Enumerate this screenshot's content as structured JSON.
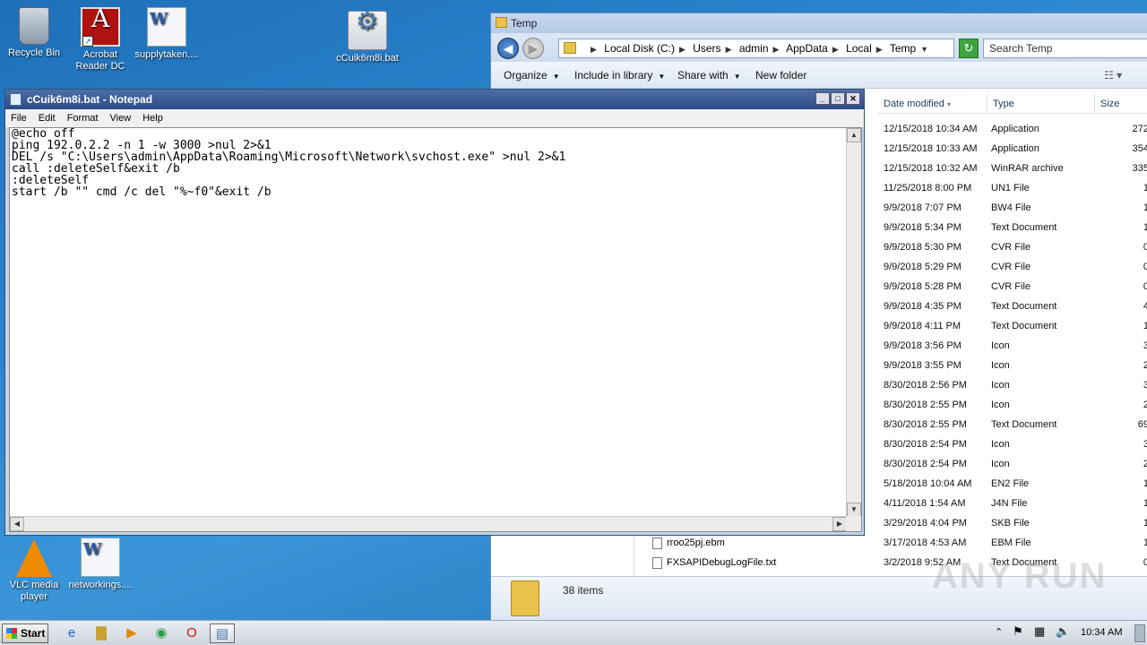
{
  "desktop": {
    "icons": [
      {
        "label": "Recycle Bin",
        "icon": "recycle-bin-icon"
      },
      {
        "label_line1": "Acrobat",
        "label_line2": "Reader DC",
        "icon": "acrobat-icon"
      },
      {
        "label": "supplytaken....",
        "icon": "word-doc-icon"
      },
      {
        "label": "cCuik6m8i.bat",
        "icon": "batch-file-icon"
      },
      {
        "label_line1": "VLC media",
        "label_line2": "player",
        "icon": "vlc-icon"
      },
      {
        "label": "networkings....",
        "icon": "word-doc-icon"
      }
    ]
  },
  "explorer": {
    "title": "Temp",
    "breadcrumb": [
      "Local Disk (C:)",
      "Users",
      "admin",
      "AppData",
      "Local",
      "Temp"
    ],
    "search_placeholder": "Search Temp",
    "toolbar": {
      "organize": "Organize",
      "include_in_library": "Include in library",
      "share_with": "Share with",
      "new_folder": "New folder"
    },
    "columns": {
      "date": "Date modified",
      "type": "Type",
      "size": "Size"
    },
    "rows": [
      {
        "date": "12/15/2018 10:34 AM",
        "type": "Application",
        "size": "272"
      },
      {
        "date": "12/15/2018 10:33 AM",
        "type": "Application",
        "size": "354"
      },
      {
        "date": "12/15/2018 10:32 AM",
        "type": "WinRAR archive",
        "size": "335"
      },
      {
        "date": "11/25/2018 8:00 PM",
        "type": "UN1 File",
        "size": "1"
      },
      {
        "date": "9/9/2018 7:07 PM",
        "type": "BW4 File",
        "size": "1"
      },
      {
        "date": "9/9/2018 5:34 PM",
        "type": "Text Document",
        "size": "1"
      },
      {
        "date": "9/9/2018 5:30 PM",
        "type": "CVR File",
        "size": "0"
      },
      {
        "date": "9/9/2018 5:29 PM",
        "type": "CVR File",
        "size": "0"
      },
      {
        "date": "9/9/2018 5:28 PM",
        "type": "CVR File",
        "size": "0"
      },
      {
        "date": "9/9/2018 4:35 PM",
        "type": "Text Document",
        "size": "4"
      },
      {
        "date": "9/9/2018 4:11 PM",
        "type": "Text Document",
        "size": "1"
      },
      {
        "date": "9/9/2018 3:56 PM",
        "type": "Icon",
        "size": "3"
      },
      {
        "date": "9/9/2018 3:55 PM",
        "type": "Icon",
        "size": "2"
      },
      {
        "date": "8/30/2018 2:56 PM",
        "type": "Icon",
        "size": "3"
      },
      {
        "date": "8/30/2018 2:55 PM",
        "type": "Icon",
        "size": "2"
      },
      {
        "date": "8/30/2018 2:55 PM",
        "type": "Text Document",
        "size": "69"
      },
      {
        "date": "8/30/2018 2:54 PM",
        "type": "Icon",
        "size": "3"
      },
      {
        "date": "8/30/2018 2:54 PM",
        "type": "Icon",
        "size": "2"
      },
      {
        "date": "5/18/2018 10:04 AM",
        "type": "EN2 File",
        "size": "1"
      },
      {
        "date": "4/11/2018 1:54 AM",
        "type": "J4N File",
        "size": "1"
      },
      {
        "date": "3/29/2018 4:04 PM",
        "type": "SKB File",
        "size": "1"
      },
      {
        "date": "3/17/2018 4:53 AM",
        "type": "EBM File",
        "size": "1",
        "name": "rroo25pj.ebm"
      },
      {
        "date": "3/2/2018 9:52 AM",
        "type": "Text Document",
        "size": "0",
        "name": "FXSAPIDebugLogFile.txt"
      }
    ],
    "item_count": "38 items",
    "watermark": "ANY RUN"
  },
  "notepad": {
    "title": "cCuik6m8i.bat - Notepad",
    "menu": [
      "File",
      "Edit",
      "Format",
      "View",
      "Help"
    ],
    "content": "@echo off\nping 192.0.2.2 -n 1 -w 3000 >nul 2>&1\nDEL /s \"C:\\Users\\admin\\AppData\\Roaming\\Microsoft\\Network\\svchost.exe\" >nul 2>&1\ncall :deleteSelf&exit /b\n:deleteSelf\nstart /b \"\" cmd /c del \"%~f0\"&exit /b"
  },
  "taskbar": {
    "start_label": "Start",
    "clock": "10:34 AM"
  }
}
